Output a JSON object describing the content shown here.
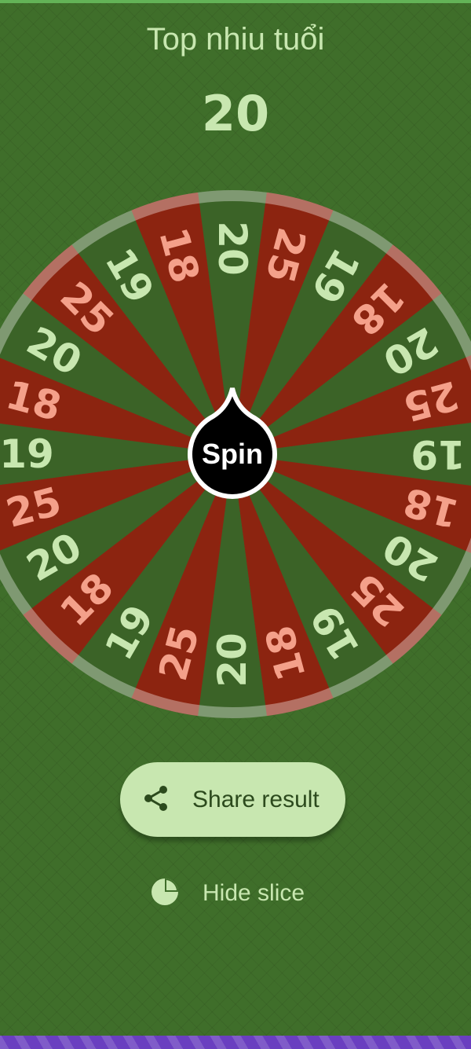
{
  "title": "Top nhiu tuổi",
  "result": "20",
  "wheel": {
    "spin_label": "Spin",
    "slices": [
      "20",
      "25",
      "19",
      "18",
      "20",
      "25",
      "19",
      "18",
      "20",
      "25",
      "19",
      "18",
      "20",
      "25",
      "19",
      "18",
      "20",
      "25",
      "19",
      "18",
      "20",
      "25",
      "19",
      "18"
    ],
    "colors": {
      "green_slice": "#3b6327",
      "red_slice": "#8c2410",
      "green_text": "#c8e7b0",
      "red_text": "#f4a08a",
      "hub": "#000000",
      "hub_text": "#ffffff"
    }
  },
  "share_button": {
    "label": "Share result",
    "icon": "share-icon"
  },
  "hide_slice": {
    "label": "Hide slice",
    "icon": "pie-chart-icon"
  }
}
